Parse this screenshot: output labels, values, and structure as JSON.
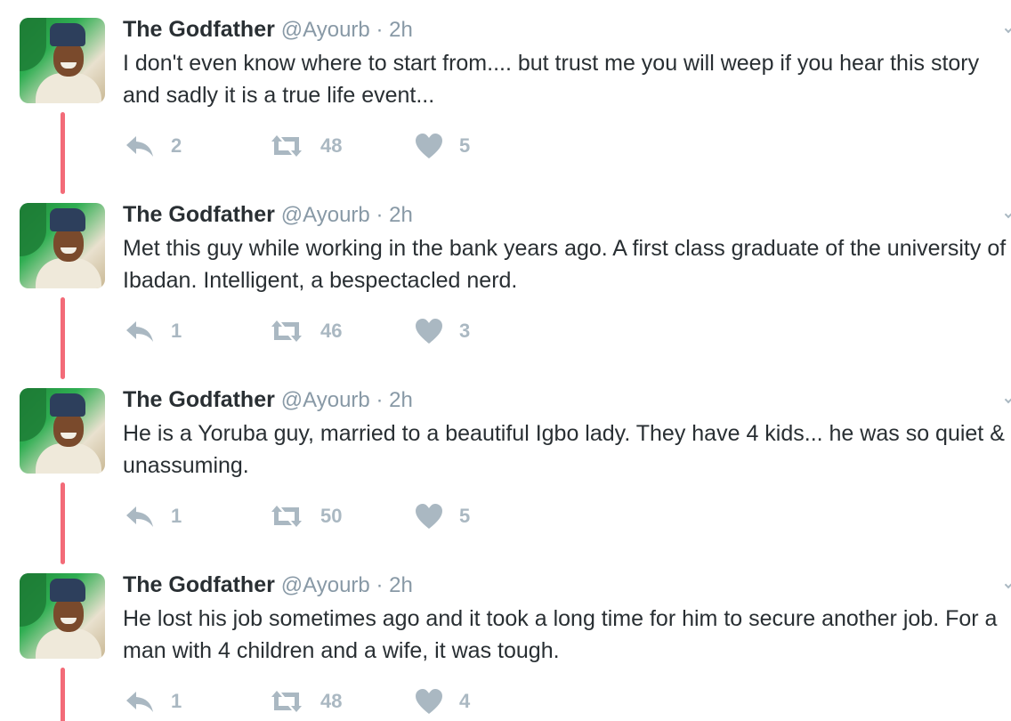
{
  "colors": {
    "thread_line": "#f36b78",
    "icon_gray": "#aab8c2",
    "handle_gray": "#8899a6",
    "name_text": "#292f33"
  },
  "tweets": [
    {
      "name": "The Godfather",
      "meta": "@Ayourb · 2h",
      "text": "I don't even know where to start from.... but trust me you will weep if you hear this story and sadly it is a true life event...",
      "replies": "2",
      "retweets": "48",
      "likes": "5",
      "icons": [
        "reply-icon",
        "retweet-icon",
        "heart-icon"
      ]
    },
    {
      "name": "The Godfather",
      "meta": "@Ayourb · 2h",
      "text": "Met this guy while working in the bank years ago. A first class graduate of the university of Ibadan. Intelligent, a bespectacled nerd.",
      "replies": "1",
      "retweets": "46",
      "likes": "3",
      "icons": [
        "reply-icon",
        "retweet-icon",
        "heart-icon"
      ]
    },
    {
      "name": "The Godfather",
      "meta": "@Ayourb · 2h",
      "text": "He is a Yoruba guy, married to a beautiful Igbo lady. They have 4 kids... he was so quiet & unassuming.",
      "replies": "1",
      "retweets": "50",
      "likes": "5",
      "icons": [
        "reply-icon",
        "retweet-icon",
        "heart-icon"
      ]
    },
    {
      "name": "The Godfather",
      "meta": "@Ayourb · 2h",
      "text": "He lost his job sometimes ago and it took a long time for him to secure another job. For a man with 4 children and a wife, it was tough.",
      "replies": "1",
      "retweets": "48",
      "likes": "4",
      "icons": [
        "reply-icon",
        "retweet-icon",
        "heart-icon"
      ]
    }
  ]
}
